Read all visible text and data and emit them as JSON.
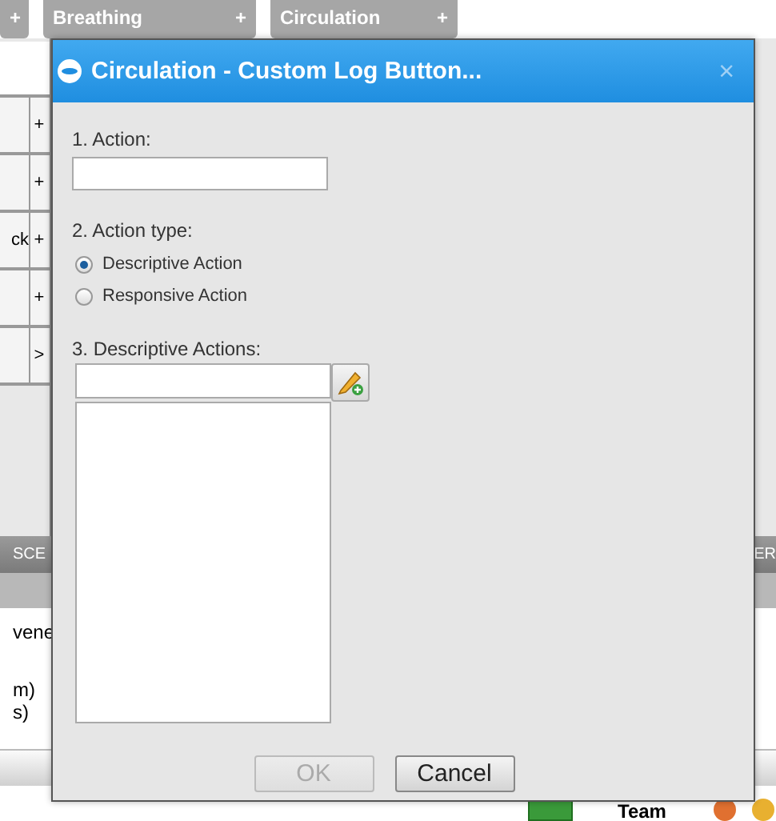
{
  "background": {
    "tabs": [
      {
        "plus": "+"
      },
      {
        "label": "Breathing",
        "plus": "+"
      },
      {
        "label": "Circulation",
        "plus": "+"
      }
    ],
    "rows": [
      {
        "button": "+"
      },
      {
        "button": "+"
      },
      {
        "label": "ck",
        "button": "+"
      },
      {
        "button": "+"
      },
      {
        "button": ">"
      }
    ],
    "section_bar": {
      "left": "SCE",
      "right": "ER"
    },
    "lines": [
      "vene",
      "m)",
      "s)"
    ],
    "footer": {
      "label": "Team"
    }
  },
  "dialog": {
    "title": "Circulation - Custom Log Button...",
    "close": "×",
    "action_label": "1. Action:",
    "action_type_label": "2. Action type:",
    "action_types": [
      {
        "label": "Descriptive Action",
        "selected": true
      },
      {
        "label": "Responsive Action",
        "selected": false
      }
    ],
    "list_label": "3. Descriptive Actions:",
    "buttons": [
      {
        "label": "OK",
        "disabled": true
      },
      {
        "label": "Cancel",
        "disabled": false
      }
    ]
  }
}
